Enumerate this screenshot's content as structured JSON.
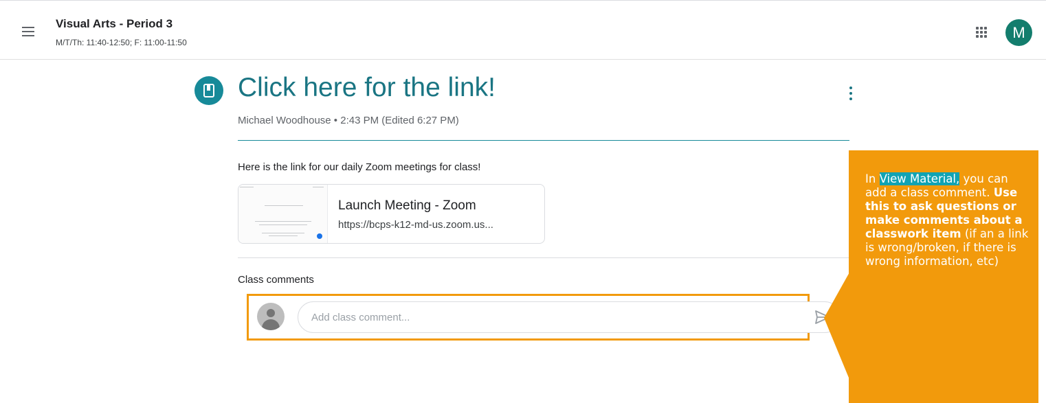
{
  "header": {
    "class_title": "Visual Arts - Period 3",
    "class_schedule": "M/T/Th: 11:40-12:50; F: 11:00-11:50",
    "avatar_initial": "M"
  },
  "post": {
    "title": "Click here for the link!",
    "meta": "Michael Woodhouse • 2:43 PM (Edited 6:27 PM)",
    "body": "Here is the link for our daily Zoom meetings for class!",
    "attachment": {
      "title": "Launch Meeting - Zoom",
      "url": "https://bcps-k12-md-us.zoom.us..."
    }
  },
  "comments": {
    "label": "Class comments",
    "placeholder": "Add class comment..."
  },
  "callout": {
    "prefix": "In ",
    "highlight": "View Material,",
    "line1": " you can add a class comment. ",
    "bold": "Use this to ask questions or make comments about a classwork item",
    "rest": " (if an a link is wrong/broken, if there is wrong information, etc)"
  },
  "colors": {
    "accent": "#1a7583",
    "post_icon": "#178a99",
    "avatar": "#137d6d",
    "callout": "#f29a0c",
    "callout_highlight": "#11a3b3"
  },
  "icons": [
    "menu-icon",
    "apps-grid-icon",
    "book-icon",
    "more-vert-icon",
    "user-placeholder-icon",
    "send-icon"
  ]
}
